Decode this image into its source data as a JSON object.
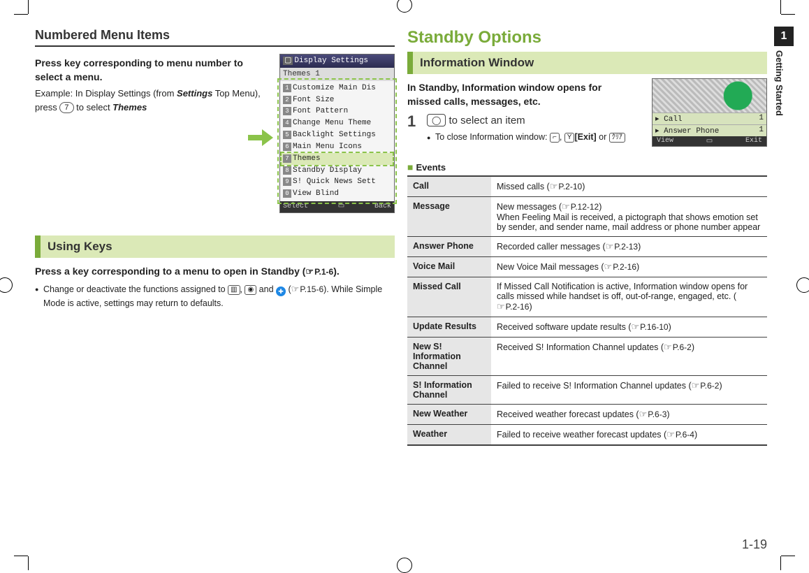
{
  "left": {
    "section_title": "Numbered Menu Items",
    "press_key_line": "Press key corresponding to menu number to select a menu.",
    "example_pre": "Example: In Display Settings (from ",
    "example_settings": "Settings",
    "example_mid": " Top Menu), press ",
    "key7": "7",
    "example_post": " to select ",
    "example_themes": "Themes",
    "using_keys_heading": "Using Keys",
    "press_key_2_pre": "Press a key corresponding to a menu to open in Standby (",
    "press_key_2_ref": "P.1-6",
    "press_key_2_post": ").",
    "bullet1_pre": "Change or deactivate the functions assigned to ",
    "bullet1_mid": " and ",
    "bullet1_ref_pre": " (",
    "bullet1_refpage": "P.15-6",
    "bullet1_post": "). While Simple Mode is active, settings may return to defaults.",
    "phone": {
      "title": "Display Settings",
      "subtitle": "Themes 1",
      "items": [
        "Customize Main Dis",
        "Font Size",
        "Font Pattern",
        "Change Menu Theme",
        "Backlight Settings",
        "Main Menu Icons",
        "Themes",
        "Standby Display",
        "S! Quick News Sett",
        "View Blind"
      ],
      "foot_left": "Select",
      "foot_right": "Back"
    }
  },
  "right": {
    "chapter_title": "Standby Options",
    "subhead": "Information Window",
    "intro": "In Standby, Information window opens for missed calls, messages, etc.",
    "step1_num": "1",
    "step1_icon": "◯",
    "step1_text": "to select an item",
    "step1_bullet_pre": "To close Information window: ",
    "step1_bullet_mid": ",",
    "step1_bullet_exit": "[Exit]",
    "step1_bullet_or": " or ",
    "events_label": "Events",
    "info_screen": {
      "row1_label": "Call",
      "row1_val": "1",
      "row2_label": "Answer Phone",
      "row2_val": "1",
      "foot_left": "View",
      "foot_right": "Exit"
    },
    "events": [
      {
        "name": "Call",
        "desc_pre": "Missed calls (",
        "ref": "P.2-10",
        "desc_post": ")"
      },
      {
        "name": "Message",
        "desc_pre": "New messages (",
        "ref": "P.12-12",
        "desc_post": ")\nWhen Feeling Mail is received, a pictograph that shows emotion set by sender, and sender name, mail address or phone number appear"
      },
      {
        "name": "Answer Phone",
        "desc_pre": "Recorded caller messages (",
        "ref": "P.2-13",
        "desc_post": ")"
      },
      {
        "name": "Voice Mail",
        "desc_pre": "New Voice Mail messages (",
        "ref": "P.2-16",
        "desc_post": ")"
      },
      {
        "name": "Missed Call",
        "desc_pre": "If Missed Call Notification is active, Information window opens for calls missed while handset is off, out-of-range, engaged, etc. (",
        "ref": "P.2-16",
        "desc_post": ")"
      },
      {
        "name": "Update Results",
        "desc_pre": "Received software update results (",
        "ref": "P.16-10",
        "desc_post": ")"
      },
      {
        "name": "New S! Information Channel",
        "desc_pre": "Received S! Information Channel updates (",
        "ref": "P.6-2",
        "desc_post": ")"
      },
      {
        "name": "S! Information Channel",
        "desc_pre": "Failed to receive S! Information Channel updates (",
        "ref": "P.6-2",
        "desc_post": ")"
      },
      {
        "name": "New Weather",
        "desc_pre": "Received weather forecast updates (",
        "ref": "P.6-3",
        "desc_post": ")"
      },
      {
        "name": "Weather",
        "desc_pre": "Failed to receive weather forecast updates (",
        "ref": "P.6-4",
        "desc_post": ")"
      }
    ]
  },
  "sidetab": {
    "num": "1",
    "label": "Getting Started"
  },
  "page_number": "1-19"
}
